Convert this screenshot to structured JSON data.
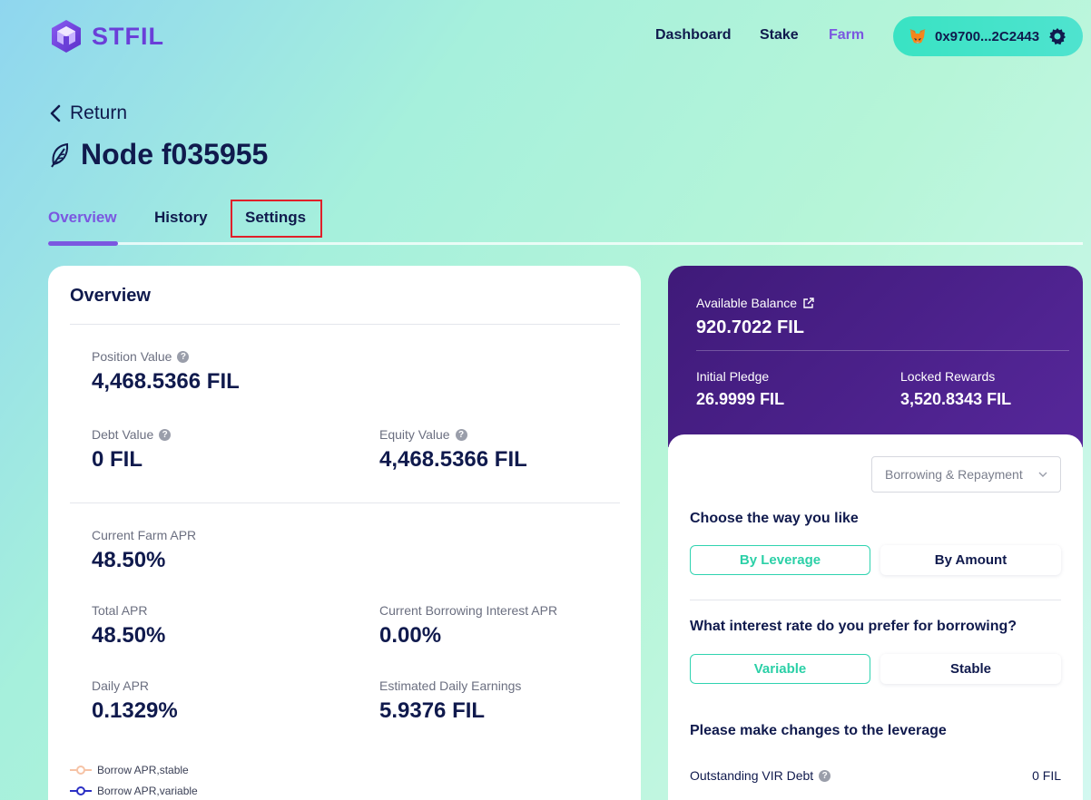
{
  "brand": {
    "name": "STFIL"
  },
  "nav": {
    "dashboard": "Dashboard",
    "stake": "Stake",
    "farm": "Farm"
  },
  "wallet": {
    "address": "0x9700...2C2443"
  },
  "return_label": "Return",
  "title": "Node f035955",
  "tabs": [
    {
      "label": "Overview",
      "active": true
    },
    {
      "label": "History"
    },
    {
      "label": "Settings",
      "highlighted": true
    }
  ],
  "overview": {
    "title": "Overview",
    "position_value": {
      "label": "Position Value",
      "value": "4,468.5366 FIL"
    },
    "debt_value": {
      "label": "Debt Value",
      "value": "0 FIL"
    },
    "equity_value": {
      "label": "Equity Value",
      "value": "4,468.5366 FIL"
    },
    "current_farm_apr": {
      "label": "Current Farm APR",
      "value": "48.50%"
    },
    "total_apr": {
      "label": "Total APR",
      "value": "48.50%"
    },
    "current_borrowing_apr": {
      "label": "Current Borrowing Interest APR",
      "value": "0.00%"
    },
    "daily_apr": {
      "label": "Daily APR",
      "value": "0.1329%"
    },
    "estimated_daily": {
      "label": "Estimated Daily Earnings",
      "value": "5.9376 FIL"
    },
    "legend": [
      "Borrow APR,stable",
      "Borrow APR,variable"
    ]
  },
  "balance": {
    "available_label": "Available Balance",
    "available_value": "920.7022 FIL",
    "initial_pledge_label": "Initial Pledge",
    "initial_pledge_value": "26.9999 FIL",
    "locked_rewards_label": "Locked Rewards",
    "locked_rewards_value": "3,520.8343 FIL"
  },
  "form": {
    "mode_select": "Borrowing & Repayment",
    "choose_way": "Choose the way you like",
    "by_leverage": "By Leverage",
    "by_amount": "By Amount",
    "rate_question": "What interest rate do you prefer for borrowing?",
    "variable": "Variable",
    "stable": "Stable",
    "leverage_prompt": "Please make changes to the leverage",
    "outstanding_label": "Outstanding VIR Debt",
    "outstanding_value": "0 FIL"
  },
  "colors": {
    "accent": "#7b57e0",
    "teal": "#2bd0a7",
    "panel": "#4a2188",
    "highlight_box": "#e0202a"
  }
}
